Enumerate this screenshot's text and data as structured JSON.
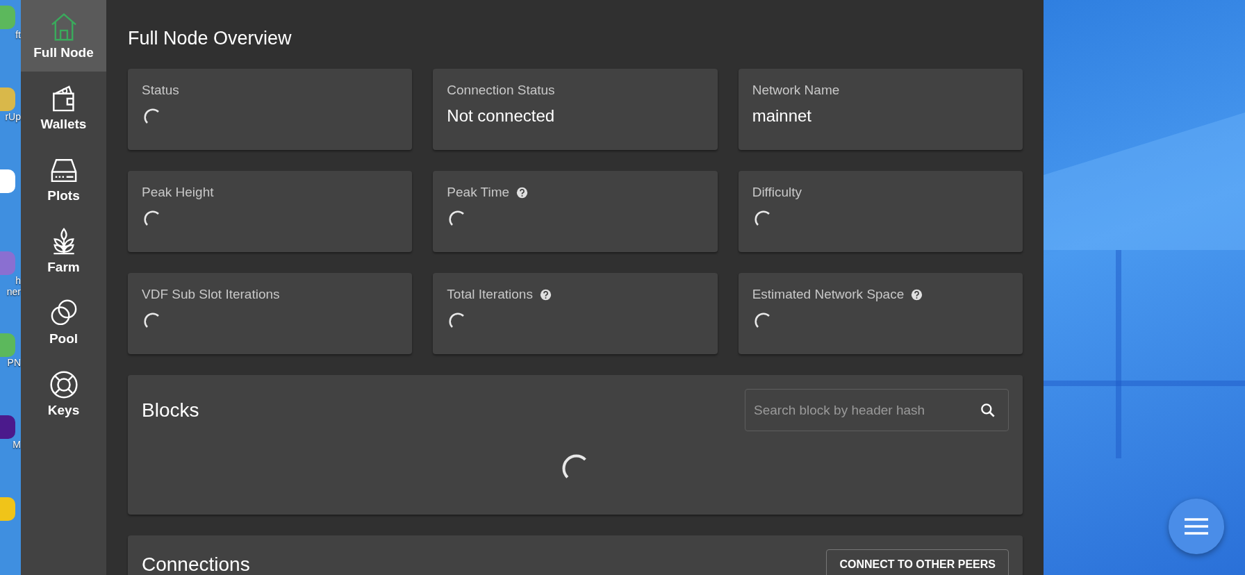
{
  "desktop_icons": [
    {
      "color": "#5cb85c",
      "lines": [
        "ft"
      ]
    },
    {
      "color": "#d9b84a",
      "lines": [
        "rUp"
      ]
    },
    {
      "color": "#ffffff"
    },
    {
      "color": "#8a6fd1",
      "lines": [
        "h",
        "ner"
      ]
    },
    {
      "color": "#5cb85c",
      "lines": [
        "PN"
      ]
    },
    {
      "color": "#4b1a8c",
      "lines": [
        "M"
      ]
    },
    {
      "color": "#f0c419"
    }
  ],
  "sidebar": {
    "items": [
      {
        "label": "Full Node",
        "selected": true
      },
      {
        "label": "Wallets",
        "selected": false
      },
      {
        "label": "Plots",
        "selected": false
      },
      {
        "label": "Farm",
        "selected": false
      },
      {
        "label": "Pool",
        "selected": false
      },
      {
        "label": "Keys",
        "selected": false
      }
    ]
  },
  "page": {
    "title": "Full Node Overview"
  },
  "cards": [
    {
      "label": "Status",
      "help": false,
      "loading": true
    },
    {
      "label": "Connection Status",
      "help": false,
      "loading": false,
      "value": "Not connected"
    },
    {
      "label": "Network Name",
      "help": false,
      "loading": false,
      "value": "mainnet"
    },
    {
      "label": "Peak Height",
      "help": false,
      "loading": true
    },
    {
      "label": "Peak Time",
      "help": true,
      "loading": true
    },
    {
      "label": "Difficulty",
      "help": false,
      "loading": true
    },
    {
      "label": "VDF Sub Slot Iterations",
      "help": false,
      "loading": true
    },
    {
      "label": "Total Iterations",
      "help": true,
      "loading": true
    },
    {
      "label": "Estimated Network Space",
      "help": true,
      "loading": true
    }
  ],
  "blocks": {
    "title": "Blocks",
    "search": {
      "placeholder": "Search block by header hash"
    },
    "loading": true
  },
  "connections": {
    "title": "Connections",
    "button": "CONNECT TO OTHER PEERS"
  }
}
